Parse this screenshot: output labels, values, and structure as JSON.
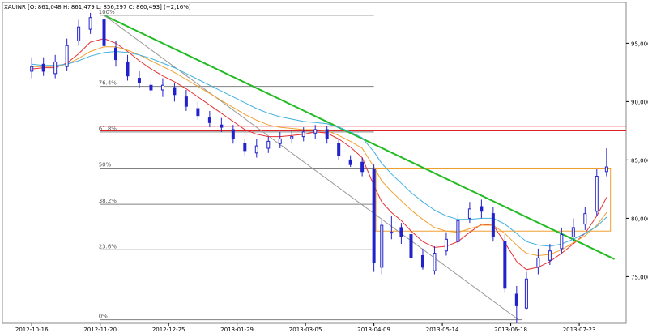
{
  "chart_data": {
    "type": "candlestick",
    "title": "XAUINR [O: 861,048 H: 861,479 L: 856,297 C: 860,493] (+2,16%)",
    "xlabel": "",
    "ylabel": "",
    "ylim": [
      71000,
      98500
    ],
    "grid": false,
    "x_tick_labels": [
      "2012-10-16",
      "2012-11-20",
      "2012-12-25",
      "2013-01-29",
      "2013-03-05",
      "2013-04-09",
      "2013-05-14",
      "2013-06-18",
      "2013-07-23"
    ],
    "y_ticks": [
      75000,
      80000,
      85000,
      90000,
      95000
    ],
    "y_tick_labels": [
      "75,000",
      "80,000",
      "85,000",
      "90,000",
      "95,000"
    ],
    "fib_levels": [
      {
        "label": "0%",
        "value": 71300
      },
      {
        "label": "23.6%",
        "value": 77300
      },
      {
        "label": "38.2%",
        "value": 81200
      },
      {
        "label": "50%",
        "value": 84300
      },
      {
        "label": "61.8%",
        "value": 87400
      },
      {
        "label": "76.4%",
        "value": 91300
      },
      {
        "label": "100%",
        "value": 97400
      }
    ],
    "red_levels": [
      87500,
      87900
    ],
    "orange_box": {
      "x_start": "2013-04-10",
      "x_end": "2013-08-08",
      "top": 84300,
      "bottom": 78900
    },
    "trendlines": [
      {
        "color": "#22bb22",
        "x1": "2012-11-22",
        "y1": 97400,
        "x2": "2013-08-10",
        "y2": 76500
      },
      {
        "color": "#999999",
        "x1": "2012-11-22",
        "y1": 97400,
        "x2": "2013-06-22",
        "y2": 71300
      }
    ],
    "series": [
      {
        "type": "candles",
        "color": "#2222cc",
        "x": [
          "2012-10-16",
          "2012-10-22",
          "2012-10-28",
          "2012-11-03",
          "2012-11-09",
          "2012-11-15",
          "2012-11-22",
          "2012-11-28",
          "2012-12-04",
          "2012-12-10",
          "2012-12-16",
          "2012-12-22",
          "2012-12-28",
          "2013-01-03",
          "2013-01-09",
          "2013-01-15",
          "2013-01-21",
          "2013-01-27",
          "2013-02-02",
          "2013-02-08",
          "2013-02-14",
          "2013-02-20",
          "2013-02-26",
          "2013-03-04",
          "2013-03-10",
          "2013-03-16",
          "2013-03-22",
          "2013-03-28",
          "2013-04-03",
          "2013-04-09",
          "2013-04-13",
          "2013-04-18",
          "2013-04-23",
          "2013-04-28",
          "2013-05-04",
          "2013-05-10",
          "2013-05-16",
          "2013-05-22",
          "2013-05-28",
          "2013-06-03",
          "2013-06-09",
          "2013-06-15",
          "2013-06-21",
          "2013-06-26",
          "2013-07-02",
          "2013-07-08",
          "2013-07-14",
          "2013-07-20",
          "2013-07-26",
          "2013-08-01",
          "2013-08-06"
        ],
        "open": [
          92600,
          93200,
          92400,
          93000,
          95200,
          96200,
          97000,
          94600,
          93400,
          92000,
          91400,
          91000,
          91200,
          90400,
          89400,
          88600,
          88000,
          87600,
          86400,
          85600,
          86000,
          86400,
          86800,
          87000,
          87300,
          87600,
          86400,
          85000,
          84800,
          84200,
          75800,
          78800,
          79200,
          78600,
          76800,
          75500,
          77200,
          78000,
          80000,
          81000,
          80400,
          78000,
          73500,
          72300,
          75800,
          76400,
          77400,
          78400,
          79500,
          80600,
          84000
        ],
        "close": [
          93000,
          92600,
          93400,
          94800,
          96400,
          97200,
          94800,
          93600,
          92200,
          91600,
          91000,
          91400,
          90600,
          89600,
          88800,
          88200,
          87800,
          86800,
          85800,
          86200,
          86600,
          86800,
          87000,
          87400,
          87600,
          86800,
          85400,
          84600,
          84000,
          76200,
          79400,
          78800,
          78400,
          76600,
          75800,
          77000,
          78200,
          79800,
          80800,
          80600,
          78400,
          74000,
          72500,
          74800,
          76600,
          77200,
          78600,
          79200,
          80400,
          83600,
          84400
        ],
        "high": [
          93800,
          93800,
          94000,
          95400,
          97000,
          97600,
          97400,
          95200,
          94000,
          92600,
          92000,
          92000,
          91600,
          91000,
          90000,
          89200,
          88600,
          88000,
          86800,
          86800,
          87000,
          87400,
          87600,
          87800,
          88000,
          87900,
          86800,
          85400,
          85200,
          84600,
          79800,
          80200,
          79600,
          79200,
          77400,
          77600,
          78800,
          80400,
          81400,
          81600,
          81000,
          78600,
          74200,
          75400,
          77400,
          77800,
          79200,
          80000,
          81000,
          84200,
          86000
        ],
        "low": [
          92000,
          92200,
          92000,
          92600,
          94800,
          95800,
          94400,
          93000,
          91800,
          91200,
          90600,
          90400,
          90000,
          89200,
          88400,
          87800,
          87400,
          86400,
          85400,
          85200,
          85600,
          86000,
          86400,
          86600,
          86800,
          86400,
          85000,
          84400,
          83600,
          75400,
          75200,
          78200,
          77800,
          76200,
          75600,
          75200,
          76800,
          77600,
          79600,
          80000,
          78000,
          73600,
          71000,
          72200,
          75200,
          76000,
          77000,
          78000,
          79000,
          80200,
          83600
        ]
      }
    ],
    "moving_averages": [
      {
        "color": "#e83030",
        "values": [
          92800,
          92900,
          92900,
          93300,
          94100,
          95100,
          95400,
          95000,
          94300,
          93500,
          92800,
          92200,
          91700,
          91100,
          90400,
          89700,
          89000,
          88300,
          87600,
          87200,
          87000,
          87000,
          87100,
          87200,
          87400,
          87300,
          86800,
          86100,
          85200,
          82800,
          81400,
          80500,
          79800,
          78900,
          78000,
          77500,
          77600,
          78000,
          78800,
          79500,
          79400,
          77900,
          76300,
          75600,
          75800,
          76300,
          77000,
          77800,
          78700,
          80200,
          81800
        ]
      },
      {
        "color": "#f0a030",
        "values": [
          93000,
          93000,
          93000,
          93200,
          93700,
          94300,
          94700,
          94700,
          94400,
          94000,
          93500,
          93000,
          92500,
          91900,
          91300,
          90700,
          90100,
          89500,
          88900,
          88400,
          88000,
          87800,
          87700,
          87600,
          87600,
          87500,
          87100,
          86600,
          86000,
          84400,
          83200,
          82300,
          81500,
          80700,
          79900,
          79200,
          78900,
          78800,
          79100,
          79400,
          79400,
          78700,
          77700,
          77000,
          76800,
          76900,
          77300,
          77900,
          78500,
          79400,
          80500
        ]
      },
      {
        "color": "#40b0e0",
        "values": [
          93200,
          93100,
          93100,
          93200,
          93500,
          93900,
          94200,
          94300,
          94200,
          94000,
          93700,
          93300,
          92900,
          92400,
          91900,
          91400,
          90900,
          90400,
          89900,
          89400,
          89000,
          88700,
          88500,
          88300,
          88200,
          88100,
          87800,
          87400,
          86900,
          85700,
          84700,
          83800,
          83000,
          82200,
          81400,
          80700,
          80200,
          79900,
          79900,
          80000,
          80000,
          79500,
          78700,
          78000,
          77700,
          77600,
          77800,
          78200,
          78700,
          79300,
          80100
        ]
      }
    ]
  }
}
